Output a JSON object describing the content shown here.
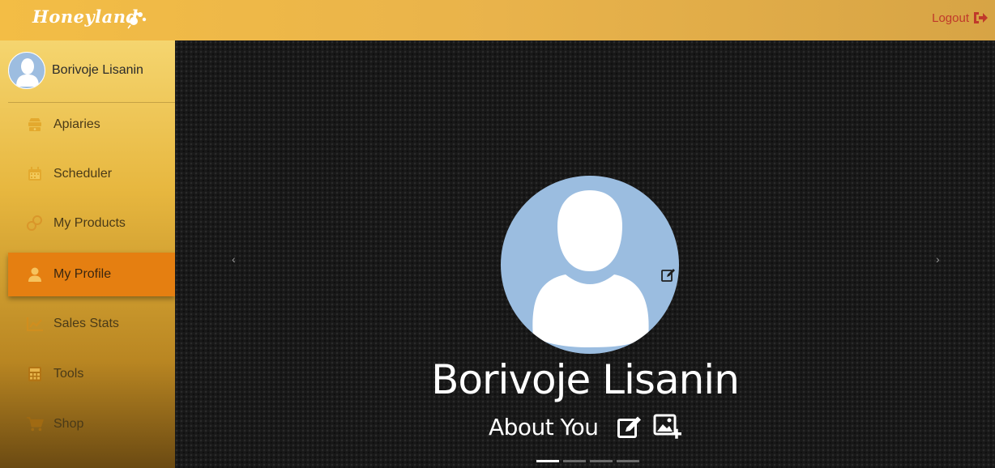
{
  "header": {
    "brand": "Honeyland",
    "logout_label": "Logout",
    "accent_color": "#c0392b"
  },
  "sidebar": {
    "user_name": "Borivoje Lisanin",
    "items": [
      {
        "label": "Apiaries",
        "icon": "beehive-icon"
      },
      {
        "label": "Scheduler",
        "icon": "calendar-icon"
      },
      {
        "label": "My Products",
        "icon": "honeycomb-icon"
      },
      {
        "label": "My Profile",
        "icon": "user-icon",
        "active": true
      },
      {
        "label": "Sales Stats",
        "icon": "chart-line-icon"
      },
      {
        "label": "Tools",
        "icon": "calculator-icon"
      },
      {
        "label": "Shop",
        "icon": "cart-icon"
      }
    ],
    "active_color": "#e57f11"
  },
  "carousel": {
    "prev_label": "‹",
    "next_label": "›",
    "profile_name": "Borivoje Lisanin",
    "about_label": "About You",
    "active_slide": 1,
    "slide_count": 4
  }
}
